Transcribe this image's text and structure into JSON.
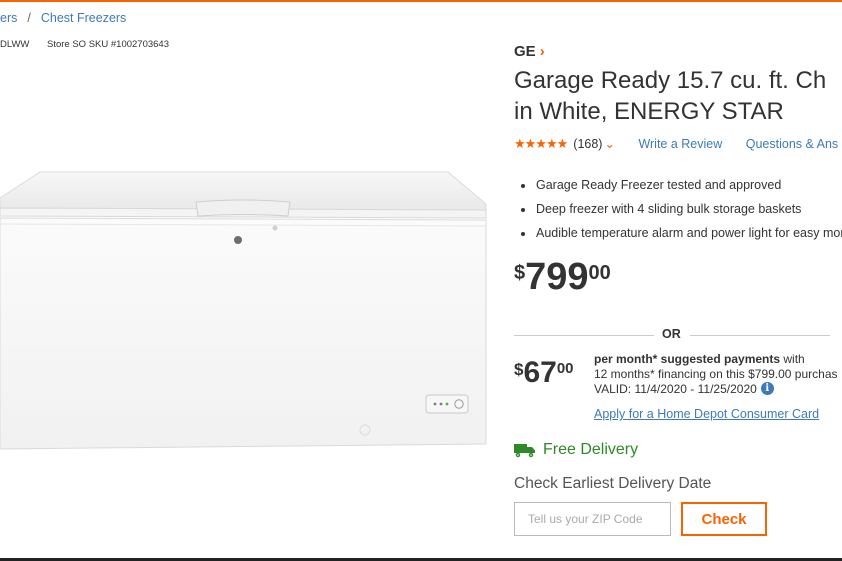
{
  "breadcrumb": {
    "prev_label": "ers",
    "separator": "/",
    "current_label": "Chest Freezers"
  },
  "meta": {
    "model_fragment": "DLWW",
    "sku": "Store SO SKU #1002703643"
  },
  "product": {
    "brand": "GE",
    "title_line1": "Garage Ready 15.7 cu. ft. Ch",
    "title_line2": "in White, ENERGY STAR",
    "rating": 4.5,
    "stars": "★★★★★",
    "review_count": "(168)",
    "write_review": "Write a Review",
    "questions": "Questions & Ans",
    "bullets": [
      "Garage Ready Freezer tested and approved",
      "Deep freezer with 4 sliding bulk storage baskets",
      "Audible temperature alarm and power light for easy mor"
    ]
  },
  "price": {
    "currency": "$",
    "dollars": "799",
    "cents": "00"
  },
  "or_label": "OR",
  "financing": {
    "currency": "$",
    "dollars": "67",
    "cents": "00",
    "line1_strong": "per month* suggested payments",
    "line1_rest": " with",
    "line2": "12 months* financing on this $799.00 purchas",
    "line3": "VALID: 11/4/2020 - 11/25/2020",
    "apply_link": "Apply for a Home Depot Consumer Card"
  },
  "delivery": {
    "free_label": "Free Delivery",
    "check_label": "Check Earliest Delivery Date",
    "zip_placeholder": "Tell us your ZIP Code",
    "check_button": "Check"
  },
  "colors": {
    "accent": "#f96302",
    "link": "#3e7bb6",
    "delivery_green": "#2e8a28"
  },
  "icons": [
    "chevron-right-icon",
    "chevron-down-icon",
    "info-icon",
    "truck-icon"
  ]
}
